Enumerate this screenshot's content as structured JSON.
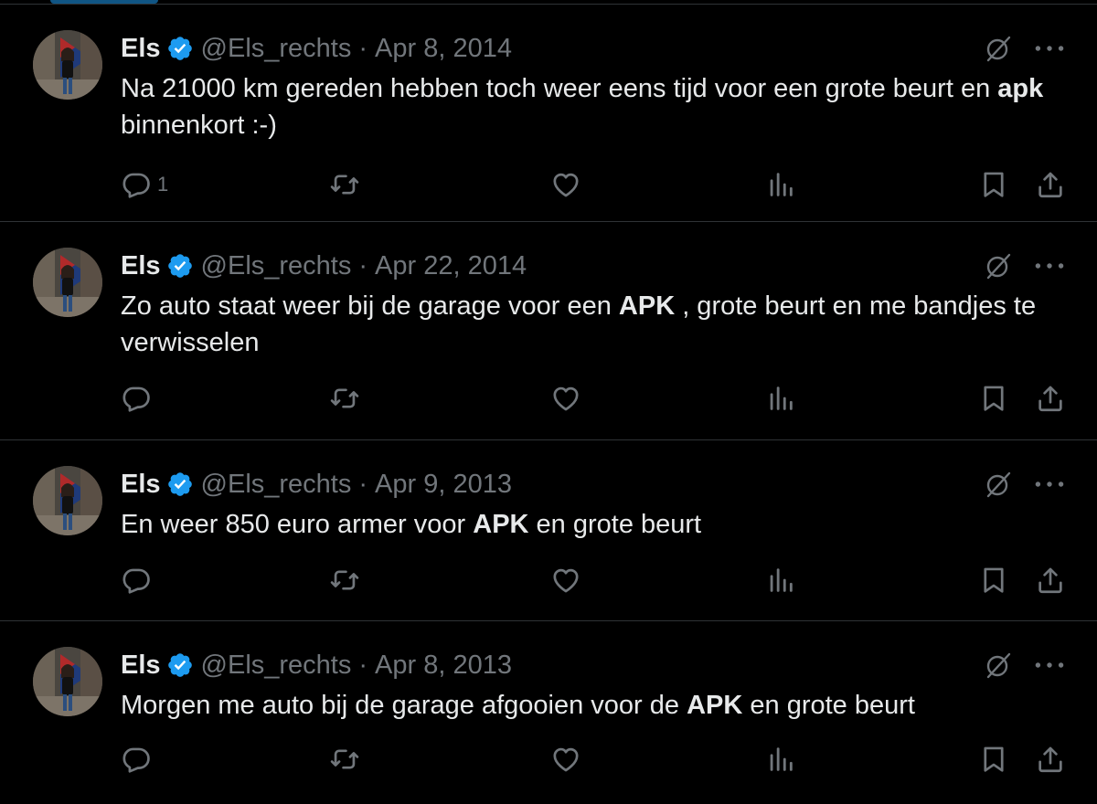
{
  "tweets": [
    {
      "name": "Els",
      "handle": "@Els_rechts",
      "separator": "·",
      "date": "Apr 8, 2014",
      "text_parts": [
        {
          "t": "Na 21000 km gereden hebben toch weer eens tijd voor een grote beurt en ",
          "bold": false
        },
        {
          "t": "apk",
          "bold": true
        },
        {
          "t": " binnenkort :-)",
          "bold": false
        }
      ],
      "reply_count": "1"
    },
    {
      "name": "Els",
      "handle": "@Els_rechts",
      "separator": "·",
      "date": "Apr 22, 2014",
      "text_parts": [
        {
          "t": "Zo auto staat weer bij de garage voor een ",
          "bold": false
        },
        {
          "t": "APK",
          "bold": true
        },
        {
          "t": " , grote beurt en me bandjes te verwisselen",
          "bold": false
        }
      ],
      "reply_count": ""
    },
    {
      "name": "Els",
      "handle": "@Els_rechts",
      "separator": "·",
      "date": "Apr 9, 2013",
      "text_parts": [
        {
          "t": "En weer 850 euro armer voor ",
          "bold": false
        },
        {
          "t": "APK",
          "bold": true
        },
        {
          "t": " en grote beurt",
          "bold": false
        }
      ],
      "reply_count": ""
    },
    {
      "name": "Els",
      "handle": "@Els_rechts",
      "separator": "·",
      "date": "Apr 8, 2013",
      "text_parts": [
        {
          "t": "Morgen me auto bij de garage afgooien voor de ",
          "bold": false
        },
        {
          "t": "APK",
          "bold": true
        },
        {
          "t": " en grote beurt",
          "bold": false
        }
      ],
      "reply_count": ""
    }
  ],
  "icons": {
    "verified": "verified-badge-icon",
    "grok": "grok-icon",
    "more": "more-icon",
    "reply": "reply-icon",
    "retweet": "retweet-icon",
    "like": "like-icon",
    "views": "views-icon",
    "bookmark": "bookmark-icon",
    "share": "share-icon"
  },
  "colors": {
    "background": "#000000",
    "text": "#e7e9ea",
    "muted": "#71767b",
    "border": "#2f3336",
    "verified": "#1d9bf0"
  }
}
